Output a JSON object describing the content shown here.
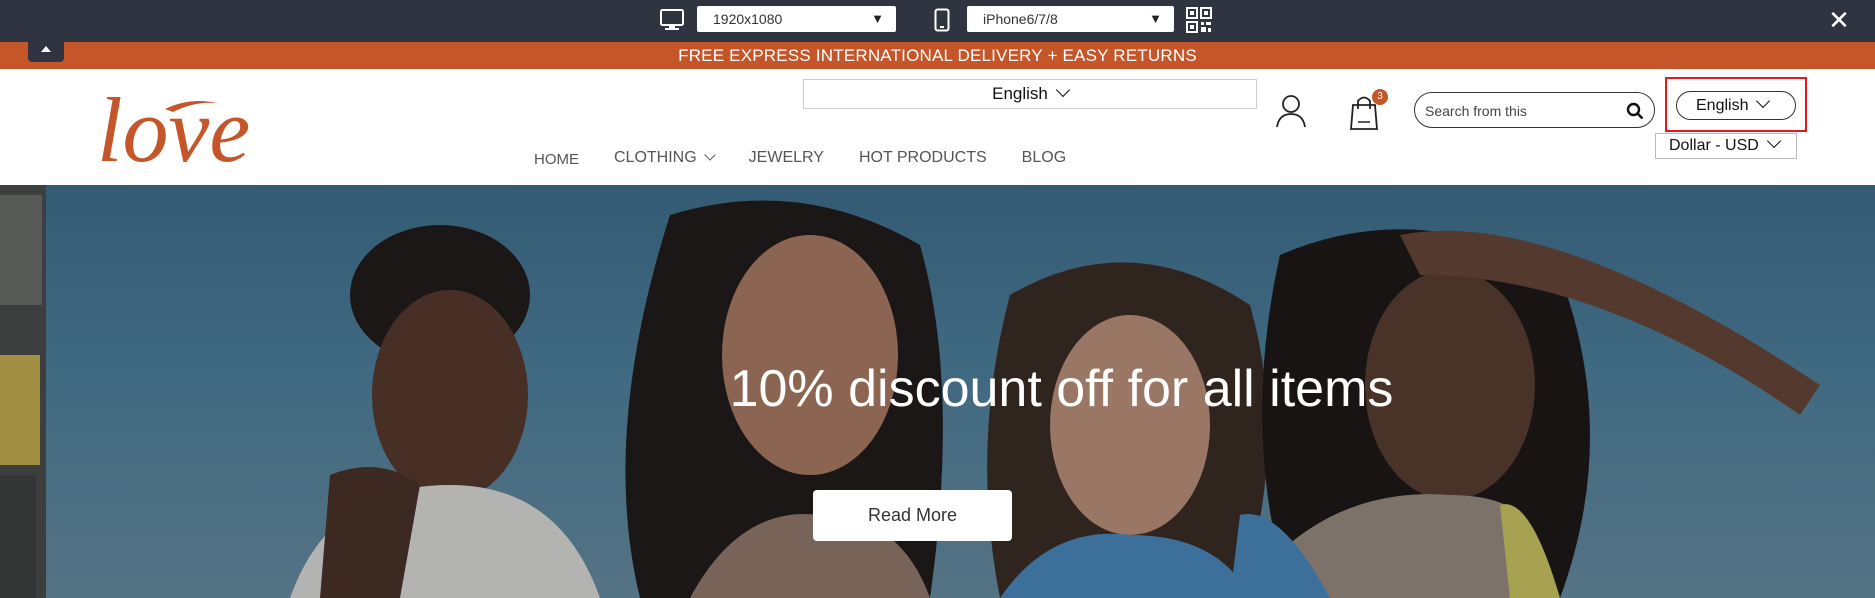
{
  "devbar": {
    "desktop_icon": "desktop-monitor-icon",
    "resolution_value": "1920x1080",
    "mobile_icon": "smartphone-icon",
    "device_value": "iPhone6/7/8",
    "qr_icon": "qr-code-icon",
    "close_icon": "close-icon"
  },
  "promo": {
    "text": "FREE EXPRESS INTERNATIONAL DELIVERY + EASY RETURNS"
  },
  "header": {
    "logo_text": "love",
    "language_top": "English",
    "cart_count": "3",
    "search_placeholder": "Search from this",
    "language_right": "English",
    "currency": "Dollar - USD"
  },
  "nav": {
    "items": [
      "HOME",
      "CLOTHING",
      "JEWELRY",
      "HOT PRODUCTS",
      "BLOG"
    ]
  },
  "hero": {
    "title": "10% discount off for all items",
    "button": "Read More"
  },
  "colors": {
    "brand": "#c4562a",
    "toolbar": "#303340",
    "highlight": "#e5191d"
  }
}
